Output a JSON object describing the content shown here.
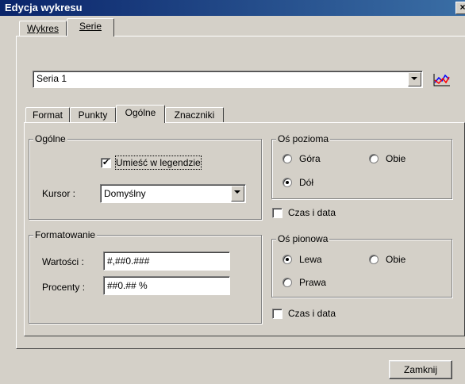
{
  "window": {
    "title": "Edycja wykresu",
    "close_glyph": "×"
  },
  "outer_tabs": [
    {
      "label": "Wykres",
      "active": false
    },
    {
      "label": "Serie",
      "active": true
    }
  ],
  "series_select": {
    "value": "Seria 1"
  },
  "series_chart_icon": "line-chart-icon",
  "inner_tabs": [
    {
      "label": "Format",
      "active": false
    },
    {
      "label": "Punkty",
      "active": false
    },
    {
      "label": "Ogólne",
      "active": true
    },
    {
      "label": "Znaczniki",
      "active": false
    }
  ],
  "general": {
    "group_label": "Ogólne",
    "show_in_legend": {
      "label": "Umieść w legendzie",
      "checked": true
    },
    "cursor_label": "Kursor :",
    "cursor_value": "Domyślny"
  },
  "formatting": {
    "group_label": "Formatowanie",
    "values_label": "Wartości :",
    "values_value": "#,##0.###",
    "percent_label": "Procenty :",
    "percent_value": "##0.## %"
  },
  "horizontal_axis": {
    "group_label": "Oś pozioma",
    "options": [
      {
        "label": "Góra",
        "checked": false
      },
      {
        "label": "Obie",
        "checked": false
      },
      {
        "label": "Dół",
        "checked": true
      }
    ],
    "datetime_label": "Czas i data",
    "datetime_checked": false
  },
  "vertical_axis": {
    "group_label": "Oś pionowa",
    "options": [
      {
        "label": "Lewa",
        "checked": true
      },
      {
        "label": "Obie",
        "checked": false
      },
      {
        "label": "Prawa",
        "checked": false
      }
    ],
    "datetime_label": "Czas i data",
    "datetime_checked": false
  },
  "close_button": {
    "label": "Zamknij"
  }
}
